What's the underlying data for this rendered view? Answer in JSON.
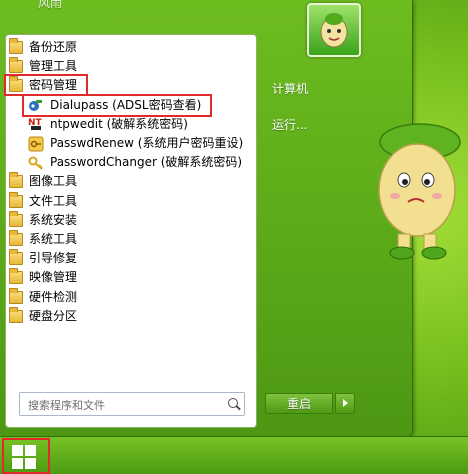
{
  "start_menu": {
    "user_name": "风雨",
    "programs": [
      {
        "label": "备份还原",
        "icon": "folder-icon",
        "type": "folder"
      },
      {
        "label": "管理工具",
        "icon": "folder-icon",
        "type": "folder"
      },
      {
        "label": "密码管理",
        "icon": "folder-icon",
        "type": "folder",
        "highlighted": true
      },
      {
        "label": "Dialupass (ADSL密码查看)",
        "icon": "dialup-key-icon",
        "type": "app",
        "highlighted": true
      },
      {
        "label": "ntpwedit (破解系统密码)",
        "icon": "ntpwedit-icon",
        "type": "app"
      },
      {
        "label": "PasswdRenew (系统用户密码重设)",
        "icon": "passwdrenew-icon",
        "type": "app"
      },
      {
        "label": "PasswordChanger (破解系统密码)",
        "icon": "key-icon",
        "type": "app"
      },
      {
        "label": "图像工具",
        "icon": "folder-icon",
        "type": "folder"
      },
      {
        "label": "文件工具",
        "icon": "folder-icon",
        "type": "folder"
      },
      {
        "label": "系统安装",
        "icon": "folder-icon",
        "type": "folder"
      },
      {
        "label": "系统工具",
        "icon": "folder-icon",
        "type": "folder"
      },
      {
        "label": "引导修复",
        "icon": "folder-icon",
        "type": "folder"
      },
      {
        "label": "映像管理",
        "icon": "folder-icon",
        "type": "folder"
      },
      {
        "label": "硬件检测",
        "icon": "folder-icon",
        "type": "folder"
      },
      {
        "label": "硬盘分区",
        "icon": "folder-icon",
        "type": "folder"
      }
    ],
    "search": {
      "placeholder": "搜索程序和文件",
      "value": ""
    },
    "right_items": [
      {
        "label": "计算机"
      },
      {
        "label": "运行..."
      }
    ],
    "shutdown_label": "重启"
  },
  "colors": {
    "accent_green": "#5aa818",
    "highlight_red": "#e12a2a"
  }
}
